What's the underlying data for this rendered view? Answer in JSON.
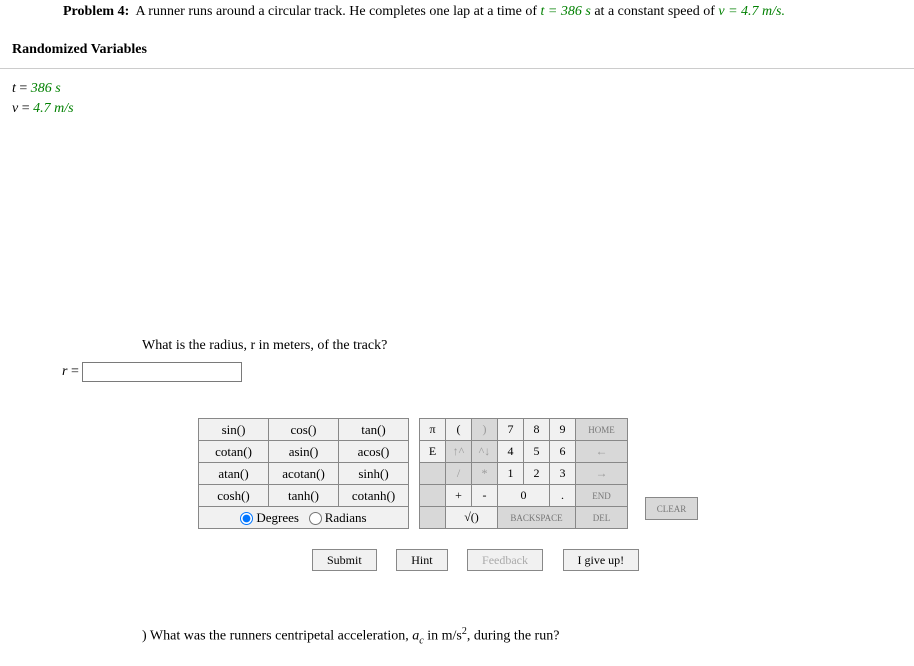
{
  "problem": {
    "label": "Problem 4:",
    "text_pre": "A runner runs around a circular track. He completes one lap at a time of ",
    "t_expr": "t = 386 s",
    "text_mid": " at a constant speed of ",
    "v_expr": "v = 4.7 m/s."
  },
  "rand_heading": "Randomized Variables",
  "vars": {
    "t_lhs": "t",
    "t_eq": " = ",
    "t_val": "386 s",
    "v_lhs": "v",
    "v_eq": " = ",
    "v_val": "4.7 m/s"
  },
  "question": "What is the radius, r in meters, of the track?",
  "answer": {
    "lhs": "r",
    "eq": " = ",
    "value": ""
  },
  "fn": {
    "r1": [
      "sin()",
      "cos()",
      "tan()"
    ],
    "r2": [
      "cotan()",
      "asin()",
      "acos()"
    ],
    "r3": [
      "atan()",
      "acotan()",
      "sinh()"
    ],
    "r4": [
      "cosh()",
      "tanh()",
      "cotanh()"
    ],
    "deg": "Degrees",
    "rad": "Radians"
  },
  "num": {
    "pi": "π",
    "lp": "(",
    "rp": ")",
    "n7": "7",
    "n8": "8",
    "n9": "9",
    "home": "HOME",
    "E": "E",
    "up": "↑^",
    "dn": "^↓",
    "n4": "4",
    "n5": "5",
    "n6": "6",
    "left": "←",
    "slash": "/",
    "star": "*",
    "n1": "1",
    "n2": "2",
    "n3": "3",
    "right": "→",
    "plus": "+",
    "minus": "-",
    "n0": "0",
    "dot": ".",
    "end": "END",
    "sqrt": "√()",
    "bksp": "BACKSPACE",
    "del": "DEL",
    "clear": "CLEAR"
  },
  "btns": {
    "submit": "Submit",
    "hint": "Hint",
    "feedback": "Feedback",
    "giveup": "I give up!"
  },
  "followup": {
    "paren": ")",
    "text_pre": " What was the runners centripetal acceleration, ",
    "a": "a",
    "sub": "c",
    "text_mid": " in m/s",
    "sup": "2",
    "text_post": ", during the run?"
  }
}
